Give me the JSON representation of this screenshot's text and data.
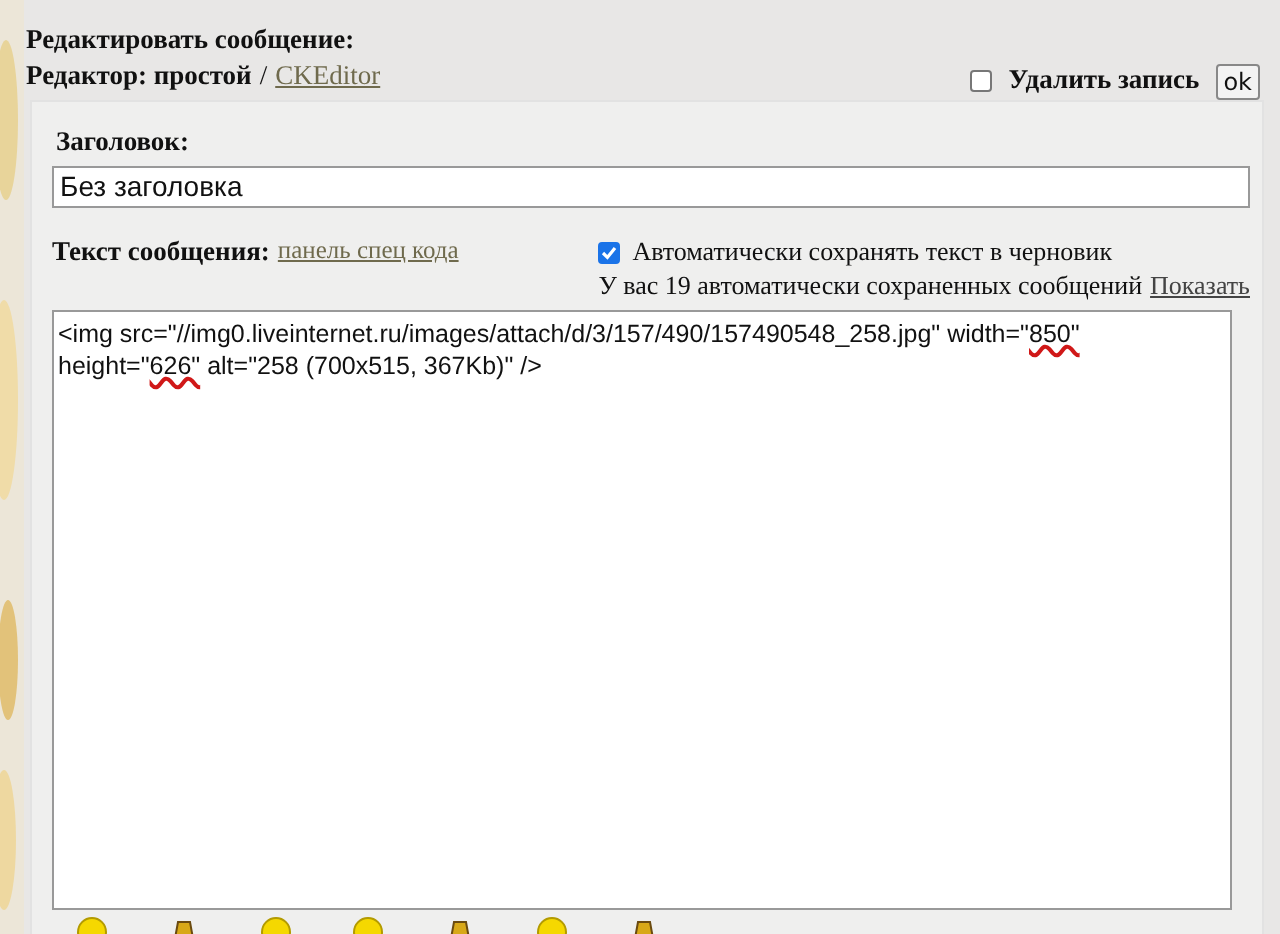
{
  "header": {
    "title": "Редактировать сообщение:",
    "editor_label": "Редактор: простой",
    "separator": "/",
    "editor_link": "CKEditor"
  },
  "delete": {
    "label": "Удалить запись",
    "checked": false,
    "button": "ok"
  },
  "subject": {
    "label": "Заголовок:",
    "value": "Без заголовка"
  },
  "message": {
    "label": "Текст сообщения:",
    "code_panel_link": "панель спец кода",
    "autosave": {
      "label": "Автоматически сохранять текст в черновик",
      "checked": true
    },
    "drafts_note": "У вас 19 автоматически сохраненных сообщений",
    "drafts_link": "Показать",
    "content": [
      {
        "text": "<img src=\"//img0.liveinternet.ru/images/attach/d/3/157/490/157490548_258.jpg\" width=\"",
        "marked": false
      },
      {
        "text": "850\"",
        "marked": true
      },
      {
        "text": " height=\"",
        "marked": false
      },
      {
        "text": "626\"",
        "marked": true
      },
      {
        "text": " alt=\"258 (700x515, 367Kb)\" />",
        "marked": false
      }
    ]
  },
  "emoticons": [
    {
      "kind": "smile"
    },
    {
      "kind": "figure"
    },
    {
      "kind": "smile"
    },
    {
      "kind": "smile"
    },
    {
      "kind": "figure"
    },
    {
      "kind": "smile"
    },
    {
      "kind": "figure"
    }
  ]
}
